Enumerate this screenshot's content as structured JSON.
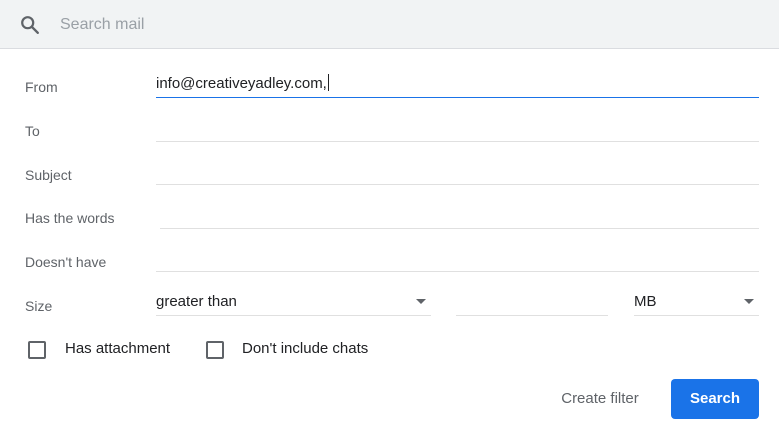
{
  "search": {
    "placeholder": "Search mail",
    "icon": "search-icon"
  },
  "filters": {
    "from": {
      "label": "From",
      "value": "info@creativeyadley.com,"
    },
    "to": {
      "label": "To",
      "value": ""
    },
    "subject": {
      "label": "Subject",
      "value": ""
    },
    "has_words": {
      "label": "Has the words",
      "value": ""
    },
    "doesnt_have": {
      "label": "Doesn't have",
      "value": ""
    },
    "size": {
      "label": "Size",
      "operator": "greater than",
      "value": "",
      "unit": "MB"
    }
  },
  "options": {
    "has_attachment": {
      "label": "Has attachment",
      "checked": false
    },
    "dont_include_chats": {
      "label": "Don't include chats",
      "checked": false
    }
  },
  "actions": {
    "create_filter": "Create filter",
    "search": "Search"
  },
  "colors": {
    "accent": "#1a73e8",
    "search_bar_bg": "#f1f3f4",
    "label": "#5f6368"
  }
}
